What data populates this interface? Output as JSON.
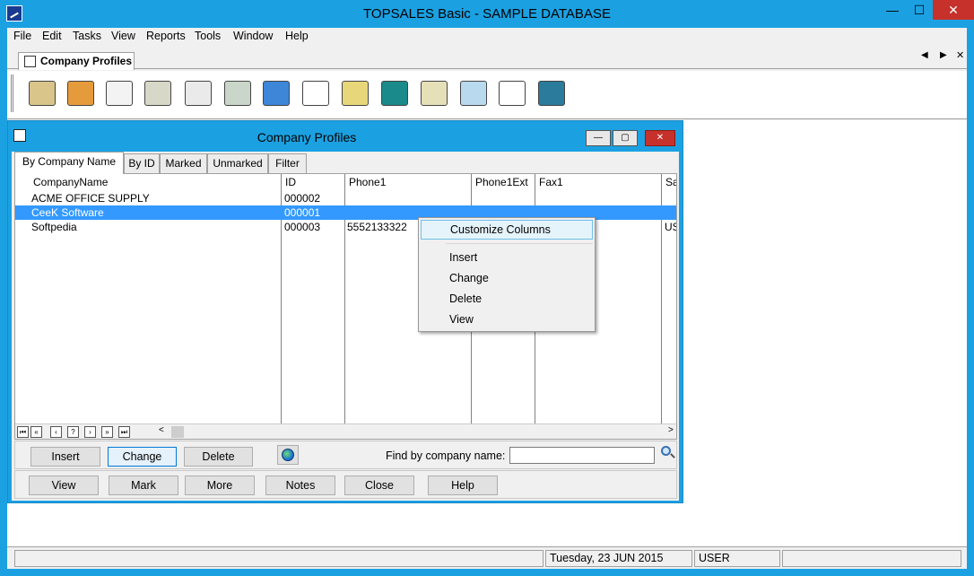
{
  "window": {
    "title": "TOPSALES Basic - SAMPLE DATABASE",
    "min_symbol": "—",
    "max_symbol": "☐",
    "close_symbol": "✕"
  },
  "menu": [
    "File",
    "Edit",
    "Tasks",
    "View",
    "Reports",
    "Tools",
    "Window",
    "Help"
  ],
  "doc_tabs": {
    "active_label": "Company Profiles",
    "prev_symbol": "◀",
    "next_symbol": "▶",
    "close_symbol": "✕"
  },
  "toolbar": {
    "icons": [
      {
        "name": "company-profiles-icon",
        "color": "#d9c48a"
      },
      {
        "name": "contacts-icon",
        "color": "#e59b3b"
      },
      {
        "name": "letter-icon",
        "color": "#f3f3f3"
      },
      {
        "name": "fax-icon",
        "color": "#d8d8c8"
      },
      {
        "name": "calendar-icon",
        "color": "#eaeaea"
      },
      {
        "name": "phone-icon",
        "color": "#c9d6c9"
      },
      {
        "name": "internet-icon",
        "color": "#3d86d8"
      },
      {
        "name": "invoice-icon",
        "color": "#ffffff"
      },
      {
        "name": "cash-register-icon",
        "color": "#e8d77a"
      },
      {
        "name": "bank-icon",
        "color": "#1b8a8a"
      },
      {
        "name": "warehouse-icon",
        "color": "#e6e0b8"
      },
      {
        "name": "projector-icon",
        "color": "#b9d9ef"
      },
      {
        "name": "stopwatch-icon",
        "color": "#ffffff"
      },
      {
        "name": "calculator-icon",
        "color": "#2a7b9c"
      }
    ]
  },
  "child": {
    "title": "Company Profiles",
    "min_symbol": "—",
    "max_symbol": "▢",
    "close_symbol": "✕",
    "tabs": [
      "By Company Name",
      "By ID",
      "Marked",
      "Unmarked",
      "Filter"
    ],
    "columns": [
      "CompanyName",
      "ID",
      "Phone1",
      "Phone1Ext",
      "Fax1",
      "Sa"
    ],
    "rows": [
      {
        "name": "ACME OFFICE SUPPLY",
        "id": "000002",
        "phone1": "",
        "ext": "",
        "fax1": "",
        "sa": ""
      },
      {
        "name": "CeeK Software",
        "id": "000001",
        "phone1": "",
        "ext": "",
        "fax1": "",
        "sa": ""
      },
      {
        "name": "Softpedia",
        "id": "000003",
        "phone1": "5552133322",
        "ext": "",
        "fax1": "",
        "sa": "US"
      }
    ],
    "nav_buttons": [
      "⏮",
      "«",
      "‹",
      "?",
      "›",
      "»",
      "⏭"
    ],
    "scroll_left": "<",
    "scroll_right": ">",
    "buttons_row1": [
      "Insert",
      "Change",
      "Delete"
    ],
    "find_label": "Find by company name:",
    "find_value": "",
    "buttons_row2": [
      "View",
      "Mark",
      "More",
      "Notes",
      "Close",
      "Help"
    ]
  },
  "context_menu": {
    "items": [
      "Customize Columns",
      "Insert",
      "Change",
      "Delete",
      "View"
    ]
  },
  "status": {
    "date": "Tuesday, 23 JUN 2015",
    "user": "USER"
  }
}
